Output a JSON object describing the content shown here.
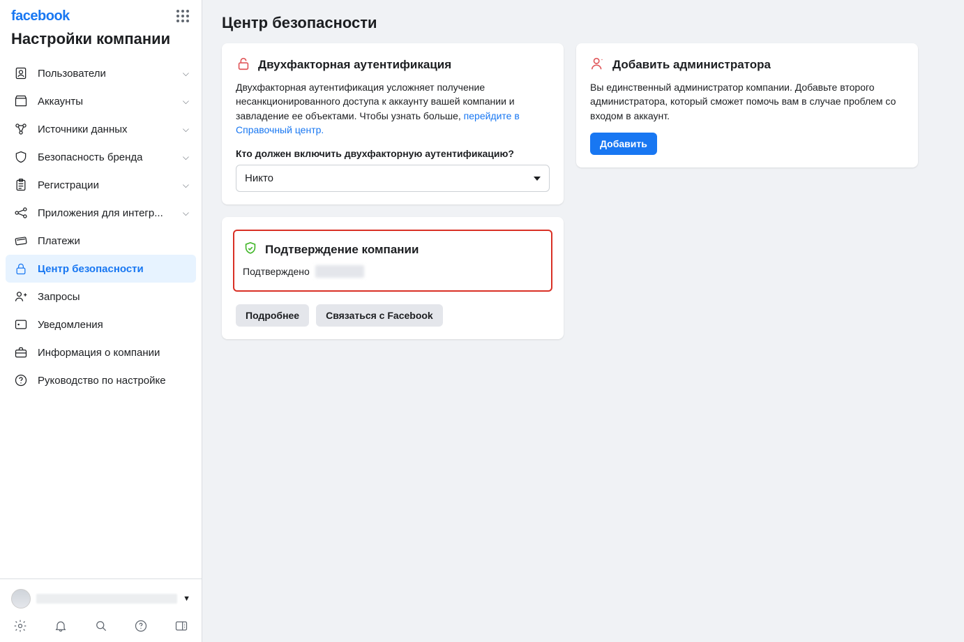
{
  "brand": "facebook",
  "page_title": "Настройки компании",
  "nav": {
    "items": [
      {
        "label": "Пользователи",
        "icon": "user-badge-icon",
        "expandable": true
      },
      {
        "label": "Аккаунты",
        "icon": "accounts-icon",
        "expandable": true
      },
      {
        "label": "Источники данных",
        "icon": "data-sources-icon",
        "expandable": true
      },
      {
        "label": "Безопасность бренда",
        "icon": "shield-icon",
        "expandable": true
      },
      {
        "label": "Регистрации",
        "icon": "clipboard-icon",
        "expandable": true
      },
      {
        "label": "Приложения для интегр...",
        "icon": "integrations-icon",
        "expandable": true
      },
      {
        "label": "Платежи",
        "icon": "payments-icon",
        "expandable": false
      },
      {
        "label": "Центр безопасности",
        "icon": "lock-icon",
        "expandable": false,
        "active": true
      },
      {
        "label": "Запросы",
        "icon": "requests-icon",
        "expandable": false
      },
      {
        "label": "Уведомления",
        "icon": "notifications-panel-icon",
        "expandable": false
      },
      {
        "label": "Информация о компании",
        "icon": "briefcase-icon",
        "expandable": false
      },
      {
        "label": "Руководство по настройке",
        "icon": "help-icon",
        "expandable": false
      }
    ]
  },
  "main": {
    "title": "Центр безопасности",
    "two_factor": {
      "title": "Двухфакторная аутентификация",
      "text": "Двухфакторная аутентификация усложняет получение несанкционированного доступа к аккаунту вашей компании и завладение ее объектами. Чтобы узнать больше, ",
      "link_text": "перейдите в Справочный центр.",
      "field_label": "Кто должен включить двухфакторную аутентификацию?",
      "select_value": "Никто"
    },
    "add_admin": {
      "title": "Добавить администратора",
      "text": "Вы единственный администратор компании. Добавьте второго администратора, который сможет помочь вам в случае проблем со входом в аккаунт.",
      "button": "Добавить"
    },
    "verification": {
      "title": "Подтверждение компании",
      "status": "Подтверждено",
      "more_button": "Подробнее",
      "contact_button": "Связаться с Facebook"
    }
  }
}
